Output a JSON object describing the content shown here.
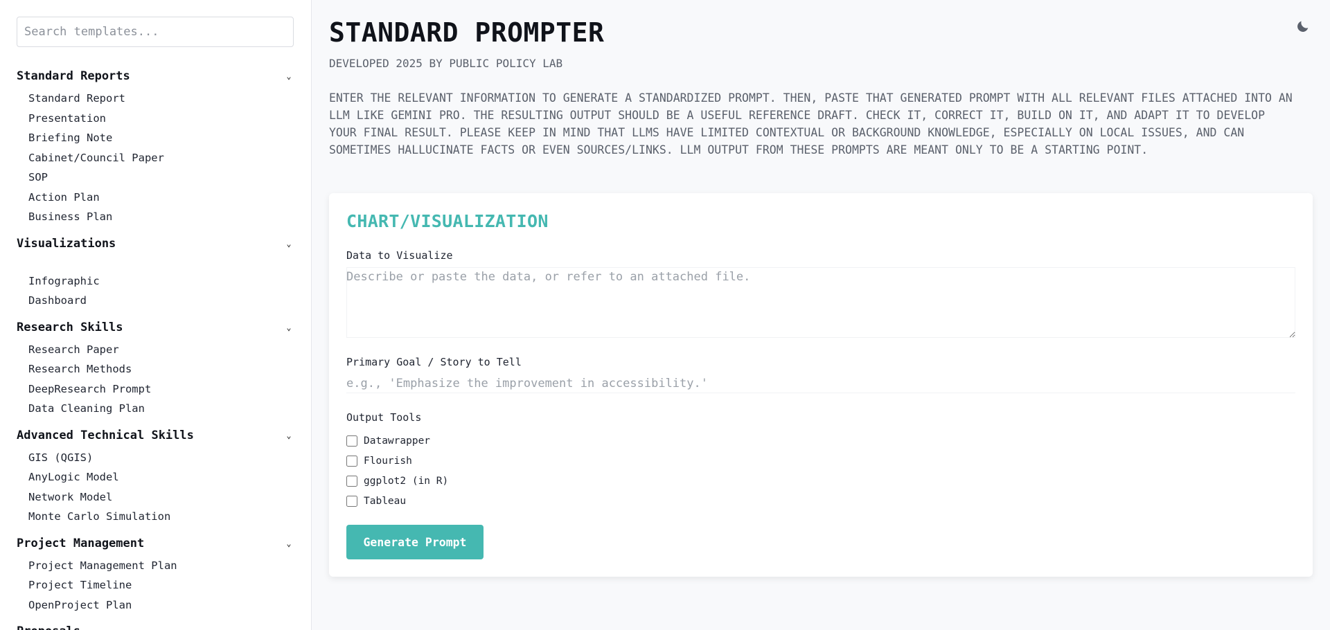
{
  "sidebar": {
    "search_placeholder": "Search templates...",
    "categories": [
      {
        "label": "Standard Reports",
        "items": [
          "Standard Report",
          "Presentation",
          "Briefing Note",
          "Cabinet/Council Paper",
          "SOP",
          "Action Plan",
          "Business Plan"
        ]
      },
      {
        "label": "Visualizations",
        "items": [
          "Infographic",
          "Dashboard"
        ]
      },
      {
        "label": "Research Skills",
        "items": [
          "Research Paper",
          "Research Methods",
          "DeepResearch Prompt",
          "Data Cleaning Plan"
        ]
      },
      {
        "label": "Advanced Technical Skills",
        "items": [
          "GIS (QGIS)",
          "AnyLogic Model",
          "Network Model",
          "Monte Carlo Simulation"
        ]
      },
      {
        "label": "Project Management",
        "items": [
          "Project Management Plan",
          "Project Timeline",
          "OpenProject Plan"
        ]
      },
      {
        "label": "Proposals",
        "items": []
      }
    ]
  },
  "header": {
    "title": "STANDARD PROMPTER",
    "subtitle": "DEVELOPED 2025 BY PUBLIC POLICY LAB",
    "intro": "ENTER THE RELEVANT INFORMATION TO GENERATE A STANDARDIZED PROMPT. THEN, PASTE THAT GENERATED PROMPT WITH ALL RELEVANT FILES ATTACHED INTO AN LLM LIKE GEMINI PRO. THE RESULTING OUTPUT SHOULD BE A USEFUL REFERENCE DRAFT. CHECK IT, CORRECT IT, BUILD ON IT, AND ADAPT IT TO DEVELOP YOUR FINAL RESULT. PLEASE KEEP IN MIND THAT LLMS HAVE LIMITED CONTEXTUAL OR BACKGROUND KNOWLEDGE, ESPECIALLY ON LOCAL ISSUES, AND CAN SOMETIMES HALLUCINATE FACTS OR EVEN SOURCES/LINKS. LLM OUTPUT FROM THESE PROMPTS ARE MEANT ONLY TO BE A STARTING POINT.",
    "theme_icon": "moon-icon"
  },
  "form": {
    "title": "CHART/VISUALIZATION",
    "data_label": "Data to Visualize",
    "data_placeholder": "Describe or paste the data, or refer to an attached file.",
    "data_value": "",
    "goal_label": "Primary Goal / Story to Tell",
    "goal_placeholder": "e.g., 'Emphasize the improvement in accessibility.'",
    "goal_value": "",
    "tools_label": "Output Tools",
    "tools": [
      {
        "label": "Datawrapper",
        "checked": false
      },
      {
        "label": "Flourish",
        "checked": false
      },
      {
        "label": "ggplot2 (in R)",
        "checked": false
      },
      {
        "label": "Tableau",
        "checked": false
      }
    ],
    "button_label": "Generate Prompt"
  },
  "colors": {
    "accent": "#45b8b1",
    "background": "#f8f9fb",
    "muted_text": "#5b616c"
  }
}
